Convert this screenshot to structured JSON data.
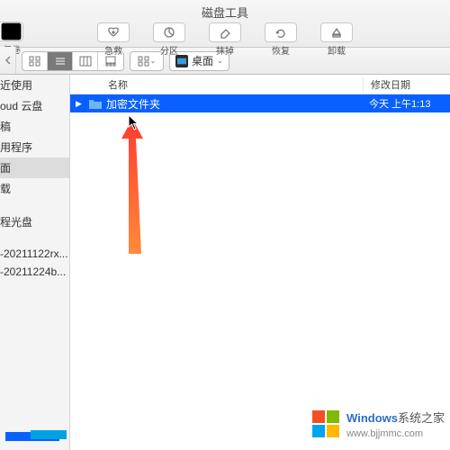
{
  "window": {
    "title": "磁盘工具"
  },
  "toolbar": {
    "back_label": "仅卷",
    "items": [
      {
        "name": "first-aid",
        "label": "急救"
      },
      {
        "name": "partition",
        "label": "分区"
      },
      {
        "name": "erase",
        "label": "抹掉"
      },
      {
        "name": "restore",
        "label": "恢复"
      },
      {
        "name": "unmount",
        "label": "卸载"
      }
    ]
  },
  "location": {
    "label": "桌面"
  },
  "sidebar": {
    "items": [
      "近使用",
      "oud 云盘",
      "稿",
      "用程序",
      "面",
      "载"
    ],
    "section2_label": "",
    "items2": [
      "程光盘",
      "-20211122rx...",
      "-20211224b..."
    ],
    "selected_index": 4
  },
  "columns": {
    "name": "名称",
    "date": "修改日期"
  },
  "rows": [
    {
      "name": "加密文件夹",
      "date": "今天 上午1:13",
      "selected": true
    }
  ],
  "watermark": {
    "brand": "Windows",
    "tail": "系统之家",
    "url": "www.bjjmmc.com"
  }
}
